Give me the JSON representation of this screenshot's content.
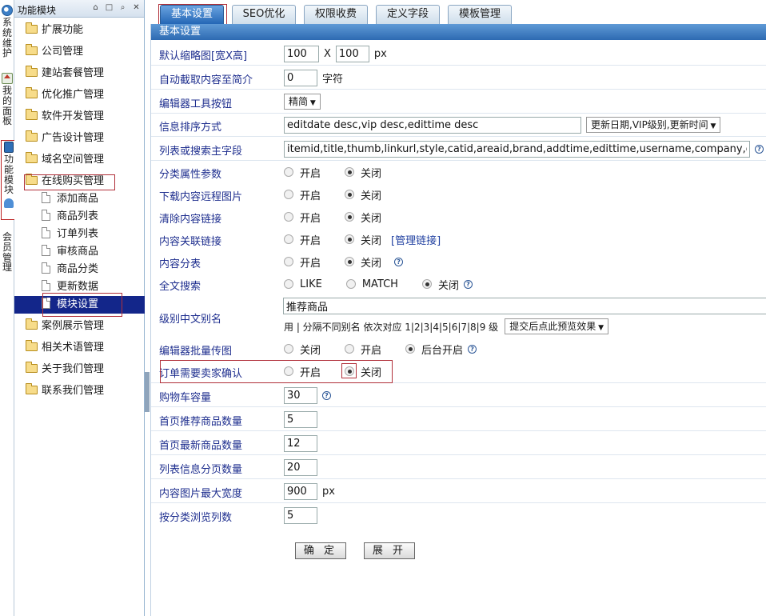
{
  "vertical_tabs": {
    "system": "系统维护",
    "panel": "我的面板",
    "function": "功能模块",
    "member": "会员管理"
  },
  "sidebar": {
    "title": "功能模块",
    "icons": [
      "home-icon",
      "window-icon",
      "search-icon",
      "close-icon"
    ],
    "items": [
      {
        "label": "扩展功能"
      },
      {
        "label": "公司管理"
      },
      {
        "label": "建站套餐管理"
      },
      {
        "label": "优化推广管理"
      },
      {
        "label": "软件开发管理"
      },
      {
        "label": "广告设计管理"
      },
      {
        "label": "域名空间管理"
      },
      {
        "label": "在线购买管理"
      },
      {
        "label": "案例展示管理"
      },
      {
        "label": "相关术语管理"
      },
      {
        "label": "关于我们管理"
      },
      {
        "label": "联系我们管理"
      }
    ],
    "subitems": [
      {
        "label": "添加商品"
      },
      {
        "label": "商品列表"
      },
      {
        "label": "订单列表"
      },
      {
        "label": "审核商品"
      },
      {
        "label": "商品分类"
      },
      {
        "label": "更新数据"
      },
      {
        "label": "模块设置"
      }
    ],
    "selected": "模块设置"
  },
  "tabs": [
    "基本设置",
    "SEO优化",
    "权限收费",
    "定义字段",
    "模板管理"
  ],
  "active_tab": "基本设置",
  "section_title": "基本设置",
  "form": {
    "thumb": {
      "label": "默认缩略图[宽X高]",
      "width": "100",
      "sep": "X",
      "height": "100",
      "unit": "px"
    },
    "intro": {
      "label": "自动截取内容至简介",
      "value": "0",
      "unit": "字符"
    },
    "toolbar": {
      "label": "编辑器工具按钮",
      "value": "精简"
    },
    "order": {
      "label": "信息排序方式",
      "value": "editdate desc,vip desc,edittime desc",
      "select": "更新日期,VIP级别,更新时间"
    },
    "fields": {
      "label": "列表或搜索主字段",
      "value": "itemid,title,thumb,linkurl,style,catid,areaid,brand,addtime,edittime,username,company,groupid"
    },
    "cat_attr": {
      "label": "分类属性参数",
      "opt1": "开启",
      "opt2": "关闭",
      "selected": "关闭"
    },
    "save_remote": {
      "label": "下载内容远程图片",
      "opt1": "开启",
      "opt2": "关闭",
      "selected": "关闭"
    },
    "clear_link": {
      "label": "清除内容链接",
      "opt1": "开启",
      "opt2": "关闭",
      "selected": "关闭"
    },
    "keylink": {
      "label": "内容关联链接",
      "opt1": "开启",
      "opt2": "关闭",
      "selected": "关闭",
      "link": "[管理链接]"
    },
    "split": {
      "label": "内容分表",
      "opt1": "开启",
      "opt2": "关闭",
      "selected": "关闭"
    },
    "fulltext": {
      "label": "全文搜索",
      "opt1": "LIKE",
      "opt2": "MATCH",
      "opt3": "关闭",
      "selected": "关闭"
    },
    "level": {
      "label": "级别中文别名",
      "value": "推荐商品",
      "note": "用 | 分隔不同别名 依次对应 1|2|3|4|5|6|7|8|9 级",
      "select": "提交后点此预览效果"
    },
    "upload": {
      "label": "编辑器批量传图",
      "opt1": "关闭",
      "opt2": "开启",
      "opt3": "后台开启",
      "selected": "后台开启"
    },
    "confirm": {
      "label": "订单需要卖家确认",
      "opt1": "开启",
      "opt2": "关闭",
      "selected": "关闭"
    },
    "cart": {
      "label": "购物车容量",
      "value": "30"
    },
    "idx_elite": {
      "label": "首页推荐商品数量",
      "value": "5"
    },
    "idx_new": {
      "label": "首页最新商品数量",
      "value": "12"
    },
    "pagesize": {
      "label": "列表信息分页数量",
      "value": "20"
    },
    "max_width": {
      "label": "内容图片最大宽度",
      "value": "900",
      "unit": "px"
    },
    "cat_cols": {
      "label": "按分类浏览列数",
      "value": "5"
    }
  },
  "buttons": {
    "submit": "确 定",
    "expand": "展 开"
  }
}
